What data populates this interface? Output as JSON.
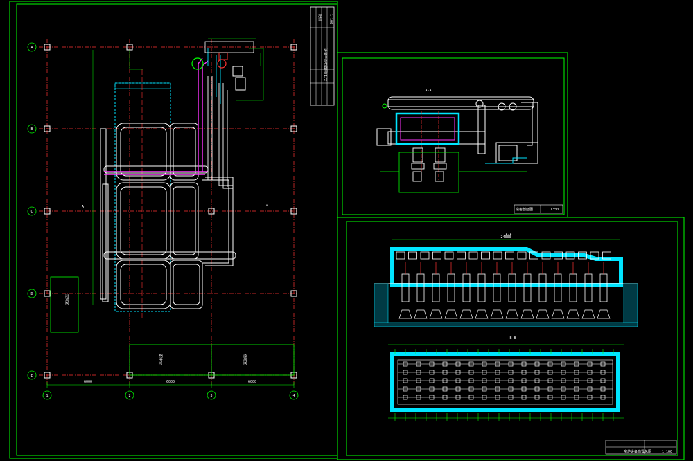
{
  "sheet": {
    "background": "#000000",
    "frame_color": "#00ff00"
  },
  "colors": {
    "frame": "#00ff00",
    "grid_axis": "#ff3333",
    "duct": "#ffffff",
    "hot_duct": "#ff33ff",
    "cyan_wall": "#00e5ff",
    "dim": "#00ff00",
    "yellow": "#ffff00"
  },
  "plan_view": {
    "axis_top_labels": [
      "1",
      "2",
      "3",
      "4"
    ],
    "axis_side_labels": [
      "A",
      "B",
      "C",
      "D",
      "E"
    ],
    "dimension_labels": [
      "6000",
      "6000",
      "6000"
    ],
    "room_labels": [
      "控制室",
      "配电室",
      "值班室"
    ],
    "section_mark_left": "A",
    "section_mark_right": "A",
    "title_block": [
      "设备平面布置图(1/2)",
      "比例",
      "1:100"
    ]
  },
  "section_view": {
    "title": "A-A",
    "title_block": [
      "设备剖面图",
      "1:50"
    ]
  },
  "elevation_view": {
    "title_top": "A-A",
    "title_bottom": "B-B",
    "overall_dim": "24000",
    "title_block": [
      "窑炉设备布置总图",
      "1:100"
    ]
  }
}
